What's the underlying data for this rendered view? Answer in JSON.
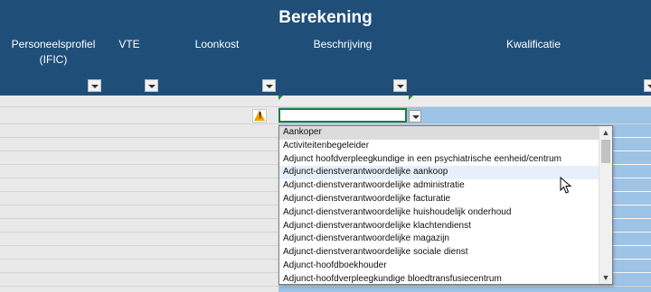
{
  "header": {
    "title": "Berekening",
    "columns": [
      {
        "label": "Personeelsprofiel (IFIC)"
      },
      {
        "label": "VTE"
      },
      {
        "label": "Loonkost"
      },
      {
        "label": "Beschrijving"
      },
      {
        "label": "Kwalificatie"
      }
    ]
  },
  "icons": {
    "warning": "warning-icon",
    "filter": "chevron-down-icon",
    "cursor": "mouse-pointer-icon"
  },
  "colors": {
    "header_bg": "#1f4e79",
    "cell_highlight": "#9dc3e6",
    "active_border": "#1e7b3c"
  },
  "dropdown": {
    "selected_index": 0,
    "hover_index": 3,
    "items": [
      "Aankoper",
      "Activiteitenbegeleider",
      "Adjunct hoofdverpleegkundige in een psychiatrische eenheid/centrum",
      "Adjunct-dienstverantwoordelijke aankoop",
      "Adjunct-dienstverantwoordelijke administratie",
      "Adjunct-dienstverantwoordelijke facturatie",
      "Adjunct-dienstverantwoordelijke huishoudelijk onderhoud",
      "Adjunct-dienstverantwoordelijke klachtendienst",
      "Adjunct-dienstverantwoordelijke magazijn",
      "Adjunct-dienstverantwoordelijke sociale dienst",
      "Adjunct-hoofdboekhouder",
      "Adjunct-hoofdverpleegkundige bloedtransfusiecentrum"
    ]
  }
}
